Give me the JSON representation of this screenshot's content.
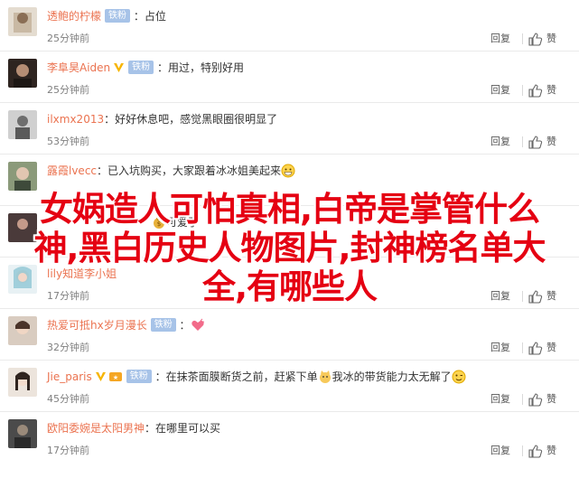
{
  "comments": [
    {
      "username": "透鲍的柠檬",
      "badge": "铁粉",
      "text": "占位",
      "time": "25分钟前",
      "avatar_color": "#c9b9a4"
    },
    {
      "username": "李阜昊Aiden",
      "badge": "铁粉",
      "text": "用过，特别好用",
      "time": "25分钟前",
      "avatar_color": "#3d2b23"
    },
    {
      "username": "ilxmx2013",
      "badge": "",
      "text": "好好休息吧，感觉黑眼圈很明显了",
      "time": "53分钟前",
      "avatar_color": "#7a7a7a"
    },
    {
      "username": "露霞lvecc",
      "badge": "",
      "text": "已入坑购买，大家跟着冰冰姐美起来",
      "time": "",
      "avatar_color": "#6a7a5a"
    },
    {
      "username": "",
      "badge": "",
      "text": "可爱了",
      "time": "",
      "avatar_color": "#4a3a3a"
    },
    {
      "username": "lily知道李小姐",
      "badge": "",
      "text": "",
      "time": "17分钟前",
      "avatar_color": "#8fc7d4"
    },
    {
      "username": "热爱可抵hx岁月漫长",
      "badge": "铁粉",
      "text": "",
      "time": "32分钟前",
      "avatar_color": "#b49a86"
    },
    {
      "username": "Jie_paris",
      "badge": "铁粉",
      "text": "在抹茶面膜断货之前，赶紧下单",
      "text2": "我冰的带货能力太无解了",
      "time": "45分钟前",
      "avatar_color": "#d8c0b0"
    },
    {
      "username": "欧阳委婉是太阳男神",
      "badge": "",
      "text": "在哪里可以买",
      "time": "17分钟前",
      "avatar_color": "#4b4b4b"
    }
  ],
  "actions": {
    "reply": "回复",
    "like": "赞"
  },
  "overlay": {
    "title": "女娲造人可怕真相,白帝是掌管什么神,黑白历史人物图片,封神榜名单大全,有哪些人"
  },
  "colors": {
    "username": "#eb7350",
    "badge": "#a7c3e8",
    "overlay": "#e50012",
    "vip": "#f7b500"
  }
}
